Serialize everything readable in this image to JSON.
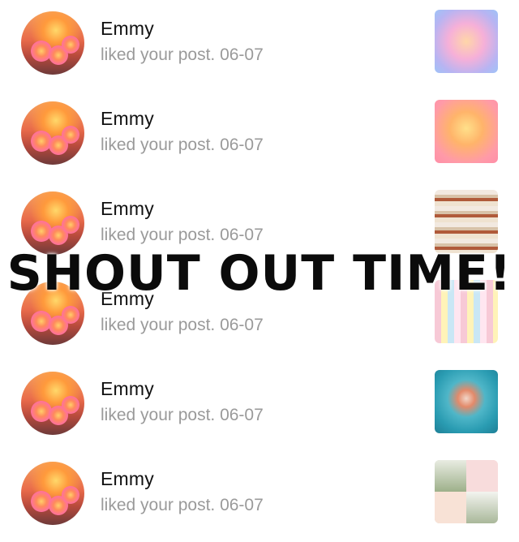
{
  "notifications": [
    {
      "name": "Emmy",
      "text": "liked your post. 06-07",
      "thumb_caption": ""
    },
    {
      "name": "Emmy",
      "text": "liked your post. 06-07",
      "thumb_caption": ""
    },
    {
      "name": "Emmy",
      "text": "liked your post. 06-07",
      "thumb_caption": ""
    },
    {
      "name": "Emmy",
      "text": "liked your post. 06-07",
      "thumb_caption": ""
    },
    {
      "name": "Emmy",
      "text": "liked your post. 06-07",
      "thumb_caption": ""
    },
    {
      "name": "Emmy",
      "text": "liked your post. 06-07",
      "thumb_caption": ""
    }
  ],
  "overlay": {
    "title": "SHOUT OUT TIME!"
  },
  "colors": {
    "name": "#111111",
    "subtext": "#9a9a9a",
    "overlay_text": "#0b0b0b"
  }
}
